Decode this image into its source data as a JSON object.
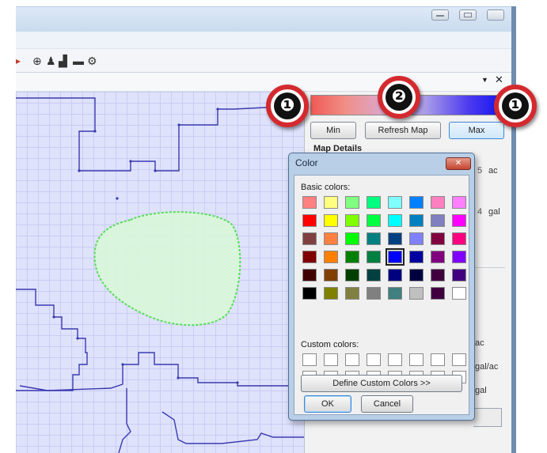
{
  "panel": {
    "close_glyph": "✕",
    "pin_glyph": "▼",
    "min_label": "Min",
    "refresh_label": "Refresh Map",
    "max_label": "Max",
    "map_details_label": "Map Details",
    "units": [
      "ac",
      "gal",
      "ac",
      "gal/ac",
      "gal"
    ]
  },
  "toolbar": {
    "icons": [
      "globe-icon",
      "user-icon",
      "bar-chart-icon",
      "folder-icon",
      "gear-icon"
    ],
    "glyphs": [
      "⊕",
      "♟",
      "▟",
      "▬",
      "⚙"
    ]
  },
  "color_scale": {
    "min_color": "#f05a56",
    "max_color": "#1414f0"
  },
  "callouts": [
    "❶",
    "❷",
    "❶"
  ],
  "color_dialog": {
    "title": "Color",
    "close_label": "✕",
    "basic_colors_label": "Basic colors:",
    "custom_colors_label": "Custom colors:",
    "define_custom_label": "Define Custom Colors >>",
    "ok_label": "OK",
    "cancel_label": "Cancel",
    "selected_color": "#0000ff",
    "basic_colors": [
      [
        "#ff8080",
        "#ffff80",
        "#80ff80",
        "#00ff80",
        "#80ffff",
        "#0080ff",
        "#ff80c0",
        "#ff80ff"
      ],
      [
        "#ff0000",
        "#ffff00",
        "#80ff00",
        "#00ff40",
        "#00ffff",
        "#0080c0",
        "#8080c0",
        "#ff00ff"
      ],
      [
        "#804040",
        "#ff8040",
        "#00ff00",
        "#008080",
        "#004080",
        "#8080ff",
        "#800040",
        "#ff0080"
      ],
      [
        "#800000",
        "#ff8000",
        "#008000",
        "#008040",
        "#0000ff",
        "#0000a0",
        "#800080",
        "#8000ff"
      ],
      [
        "#400000",
        "#804000",
        "#004000",
        "#004040",
        "#000080",
        "#000040",
        "#400040",
        "#400080"
      ],
      [
        "#000000",
        "#808000",
        "#808040",
        "#808080",
        "#408080",
        "#c0c0c0",
        "#400040",
        "#ffffff"
      ]
    ]
  }
}
